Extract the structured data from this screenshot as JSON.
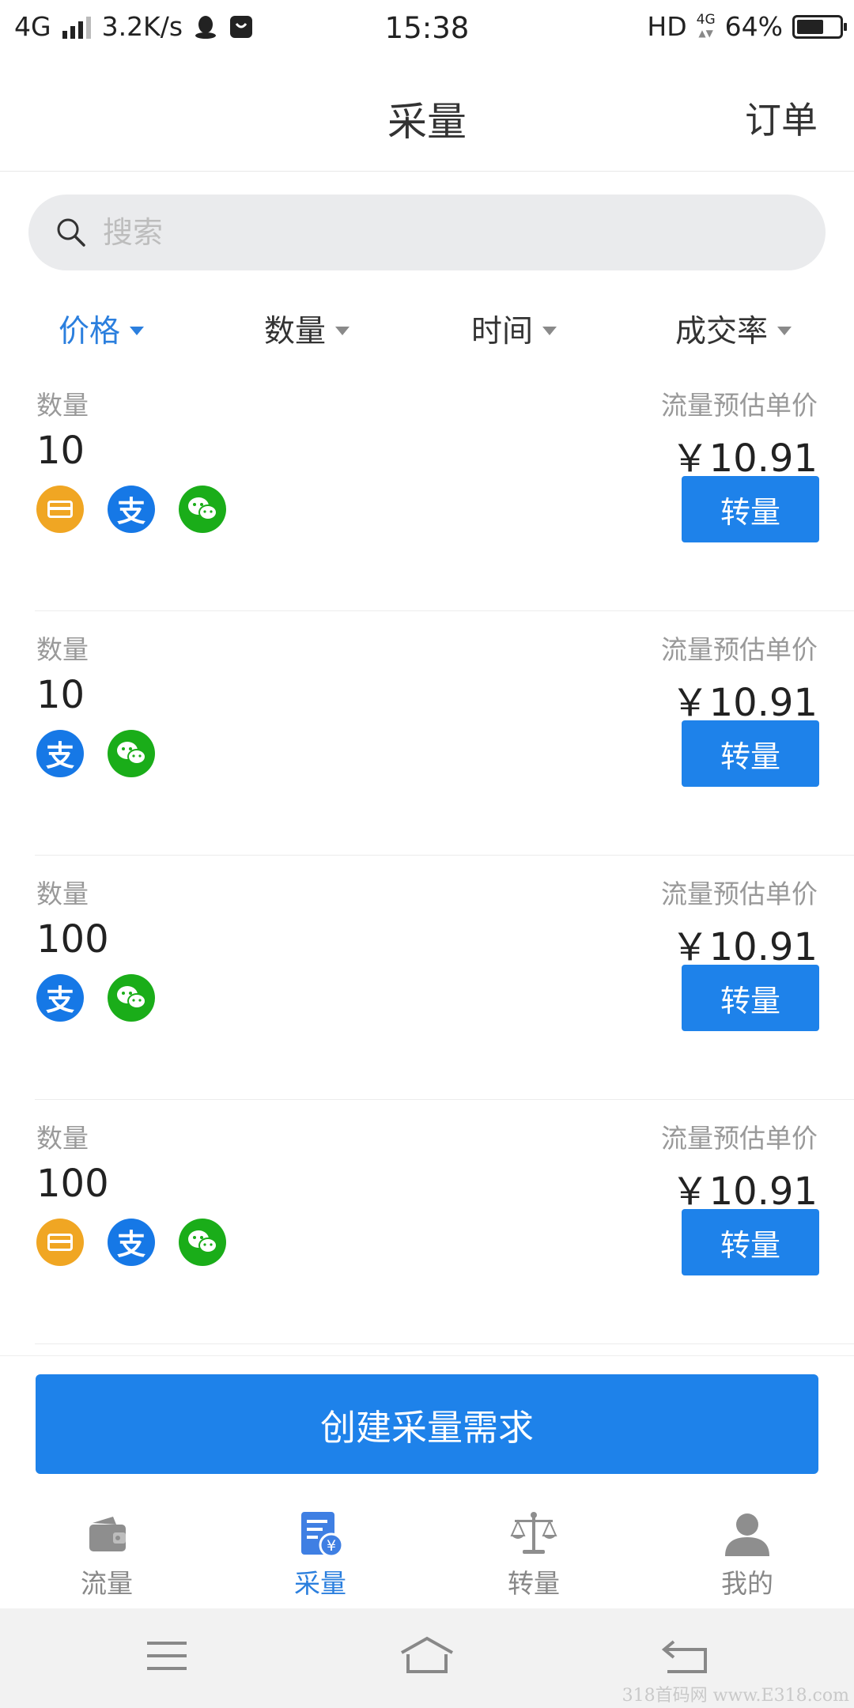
{
  "status_bar": {
    "network": "4G",
    "speed": "3.2K/s",
    "time": "15:38",
    "hd": "HD",
    "net_small": "4G",
    "battery": "64%",
    "battery_level": 0.64
  },
  "header": {
    "title": "采量",
    "orders_link": "订单"
  },
  "search": {
    "placeholder": "搜索"
  },
  "sort_tabs": [
    {
      "label": "价格",
      "active": true
    },
    {
      "label": "数量",
      "active": false
    },
    {
      "label": "时间",
      "active": false
    },
    {
      "label": "成交率",
      "active": false
    }
  ],
  "listings": [
    {
      "qty_label": "数量",
      "qty": "10",
      "price_label": "流量预估单价",
      "price": "￥10.91",
      "button": "转量",
      "payments": [
        "bank-card",
        "alipay",
        "wechat"
      ]
    },
    {
      "qty_label": "数量",
      "qty": "10",
      "price_label": "流量预估单价",
      "price": "￥10.91",
      "button": "转量",
      "payments": [
        "alipay",
        "wechat"
      ]
    },
    {
      "qty_label": "数量",
      "qty": "100",
      "price_label": "流量预估单价",
      "price": "￥10.91",
      "button": "转量",
      "payments": [
        "alipay",
        "wechat"
      ]
    },
    {
      "qty_label": "数量",
      "qty": "100",
      "price_label": "流量预估单价",
      "price": "￥10.91",
      "button": "转量",
      "payments": [
        "bank-card",
        "alipay",
        "wechat"
      ]
    }
  ],
  "create_button": "创建采量需求",
  "tab_bar": [
    {
      "label": "流量",
      "icon": "wallet-icon",
      "active": false
    },
    {
      "label": "采量",
      "icon": "purchase-doc-icon",
      "active": true
    },
    {
      "label": "转量",
      "icon": "scale-icon",
      "active": false
    },
    {
      "label": "我的",
      "icon": "person-icon",
      "active": false
    }
  ],
  "watermark": "318首码网 www.E318.com",
  "colors": {
    "accent": "#1e82ea",
    "alipay": "#1678e6",
    "wechat": "#1aad19",
    "card": "#f0a623"
  }
}
